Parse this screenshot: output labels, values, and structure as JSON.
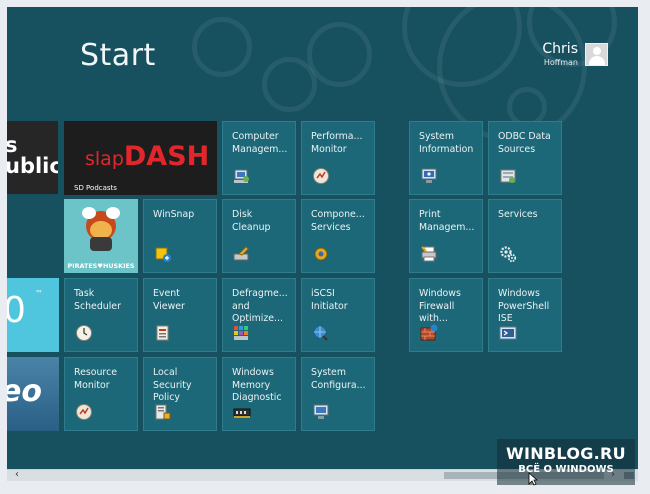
{
  "screen": {
    "title": "Start",
    "user": {
      "first_name": "Chris",
      "last_name": "Hoffman"
    }
  },
  "partial_tiles": {
    "news": {
      "line1": "s",
      "line2": "ublic"
    },
    "weather": {
      "value": "0",
      "unit": "™"
    },
    "music": {
      "text": "eo"
    }
  },
  "live_tiles": {
    "slapdash": {
      "logo_left": "slap",
      "logo_right": "DASH",
      "caption": "SD Podcasts"
    },
    "pirates": {
      "caption": "PIRATES♥HUSKIES"
    }
  },
  "tiles": [
    {
      "id": "computer-management",
      "label": "Computer Managem...",
      "icon": "computer-management-icon"
    },
    {
      "id": "performance-monitor",
      "label": "Performa... Monitor",
      "icon": "performance-monitor-icon"
    },
    {
      "id": "winsnap",
      "label": "WinSnap",
      "icon": "winsnap-icon"
    },
    {
      "id": "disk-cleanup",
      "label": "Disk Cleanup",
      "icon": "disk-cleanup-icon"
    },
    {
      "id": "component-services",
      "label": "Compone... Services",
      "icon": "component-services-icon"
    },
    {
      "id": "task-scheduler",
      "label": "Task Scheduler",
      "icon": "task-scheduler-icon"
    },
    {
      "id": "event-viewer",
      "label": "Event Viewer",
      "icon": "event-viewer-icon"
    },
    {
      "id": "defragment",
      "label": "Defragme... and Optimize...",
      "icon": "defragment-icon"
    },
    {
      "id": "iscsi-initiator",
      "label": "iSCSI Initiator",
      "icon": "iscsi-icon"
    },
    {
      "id": "resource-monitor",
      "label": "Resource Monitor",
      "icon": "resource-monitor-icon"
    },
    {
      "id": "local-security-policy",
      "label": "Local Security Policy",
      "icon": "security-policy-icon"
    },
    {
      "id": "memory-diagnostic",
      "label": "Windows Memory Diagnostic",
      "icon": "memory-icon"
    },
    {
      "id": "system-configuration",
      "label": "System Configura...",
      "icon": "system-config-icon"
    },
    {
      "id": "system-information",
      "label": "System Information",
      "icon": "system-info-icon"
    },
    {
      "id": "odbc-data-sources",
      "label": "ODBC Data Sources",
      "icon": "odbc-icon"
    },
    {
      "id": "print-management",
      "label": "Print Managem...",
      "icon": "print-management-icon"
    },
    {
      "id": "services",
      "label": "Services",
      "icon": "gears-icon"
    },
    {
      "id": "windows-firewall",
      "label": "Windows Firewall with...",
      "icon": "firewall-icon"
    },
    {
      "id": "windows-powershell-ise",
      "label": "Windows PowerShell ISE",
      "icon": "powershell-icon"
    }
  ],
  "scrollbar": {
    "left_arrow": "‹",
    "right_arrow": "›"
  },
  "watermark": {
    "title": "WINBLOG.RU",
    "subtitle": "ВСЁ О WINDOWS"
  },
  "colors": {
    "background": "#17515f",
    "tile": "#1d6878",
    "slapdash_red": "#e3262b",
    "weather_tile": "#4fc6dd"
  }
}
